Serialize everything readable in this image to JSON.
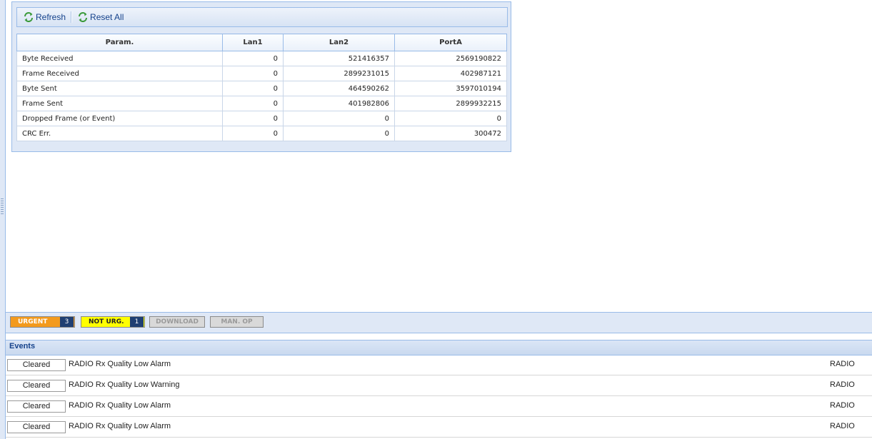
{
  "toolbar": {
    "refresh_label": "Refresh",
    "reset_label": "Reset All"
  },
  "stats_table": {
    "headers": [
      "Param.",
      "Lan1",
      "Lan2",
      "PortA"
    ],
    "rows": [
      {
        "param": "Byte Received",
        "lan1": "0",
        "lan2": "521416357",
        "porta": "2569190822"
      },
      {
        "param": "Frame Received",
        "lan1": "0",
        "lan2": "2899231015",
        "porta": "402987121"
      },
      {
        "param": "Byte Sent",
        "lan1": "0",
        "lan2": "464590262",
        "porta": "3597010194"
      },
      {
        "param": "Frame Sent",
        "lan1": "0",
        "lan2": "401982806",
        "porta": "2899932215"
      },
      {
        "param": "Dropped Frame (or Event)",
        "lan1": "0",
        "lan2": "0",
        "porta": "0"
      },
      {
        "param": "CRC Err.",
        "lan1": "0",
        "lan2": "0",
        "porta": "300472"
      }
    ]
  },
  "alarm_tabs": {
    "urgent": {
      "label": "URGENT",
      "count": "3"
    },
    "not_urgent": {
      "label": "NOT URG.",
      "count": "1"
    },
    "download": {
      "label": "DOWNLOAD"
    },
    "man_op": {
      "label": "MAN. OP"
    }
  },
  "events": {
    "title": "Events",
    "rows": [
      {
        "status": "Cleared",
        "description": "RADIO Rx Quality Low Alarm",
        "source": "RADIO"
      },
      {
        "status": "Cleared",
        "description": "RADIO Rx Quality Low Warning",
        "source": "RADIO"
      },
      {
        "status": "Cleared",
        "description": "RADIO Rx Quality Low Alarm",
        "source": "RADIO"
      },
      {
        "status": "Cleared",
        "description": "RADIO Rx Quality Low Alarm",
        "source": "RADIO"
      }
    ]
  },
  "icons": {
    "refresh": "refresh-icon",
    "reset": "reset-icon"
  },
  "colors": {
    "urgent": "#f39a1d",
    "not_urgent": "#ffff00",
    "count_badge": "#1f3f72",
    "panel_bg": "#dfe8f6",
    "header_text": "#15428b"
  }
}
